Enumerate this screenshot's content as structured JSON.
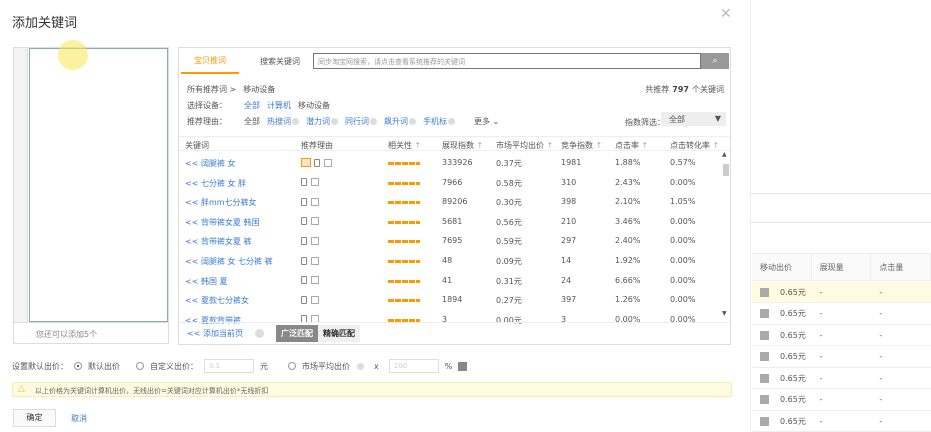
{
  "dialog": {
    "title": "添加关键词",
    "close_icon": "close-icon",
    "remaining": "您还可以添加5个"
  },
  "tabs": [
    {
      "label": "宝贝推词",
      "active": true
    },
    {
      "label": "搜索关键词",
      "active": false
    }
  ],
  "search": {
    "placeholder": "同步淘宝网搜索，请点击查看系统推荐的关键词"
  },
  "breadcrumb": {
    "root": "所有推荐词 >",
    "current": "移动设备"
  },
  "total": {
    "prefix": "共推荐",
    "count": "797",
    "suffix": "个关键词"
  },
  "device": {
    "label": "选择设备：",
    "options": [
      "全部",
      "计算机",
      "移动设备"
    ]
  },
  "reason": {
    "label": "推荐理由：",
    "options": [
      "全部",
      "热搜词",
      "潜力词",
      "同行词",
      "飙升词",
      "手机标"
    ],
    "more": "更多"
  },
  "index_filter": {
    "label": "指数筛选：",
    "value": "全部"
  },
  "columns": [
    "关键词",
    "推荐理由",
    "相关性",
    "展现指数",
    "市场平均出价",
    "竞争指数",
    "点击率",
    "点击转化率"
  ],
  "rows": [
    {
      "kw": "<< 阔腿裤 女",
      "hot": true,
      "imp": "333926",
      "price": "0.37元",
      "comp": "1981",
      "ctr": "1.88%",
      "cvr": "0.57%"
    },
    {
      "kw": "<< 七分裤 女 胖",
      "hot": false,
      "imp": "7966",
      "price": "0.58元",
      "comp": "310",
      "ctr": "2.43%",
      "cvr": "0.00%"
    },
    {
      "kw": "<< 胖mm七分裤女",
      "hot": false,
      "imp": "89206",
      "price": "0.30元",
      "comp": "398",
      "ctr": "2.10%",
      "cvr": "1.05%"
    },
    {
      "kw": "<< 背带裤女夏 韩国",
      "hot": false,
      "imp": "5681",
      "price": "0.56元",
      "comp": "210",
      "ctr": "3.46%",
      "cvr": "0.00%"
    },
    {
      "kw": "<< 背带裤女夏 裤",
      "hot": false,
      "imp": "7695",
      "price": "0.59元",
      "comp": "297",
      "ctr": "2.40%",
      "cvr": "0.00%"
    },
    {
      "kw": "<< 阔腿裤 女 七分裤 裤",
      "hot": false,
      "imp": "48",
      "price": "0.09元",
      "comp": "14",
      "ctr": "1.92%",
      "cvr": "0.00%"
    },
    {
      "kw": "<< 韩国 夏",
      "hot": false,
      "imp": "41",
      "price": "0.31元",
      "comp": "24",
      "ctr": "6.66%",
      "cvr": "0.00%"
    },
    {
      "kw": "<< 夏款七分裤女",
      "hot": false,
      "imp": "1894",
      "price": "0.27元",
      "comp": "397",
      "ctr": "1.26%",
      "cvr": "0.00%"
    },
    {
      "kw": "<< 夏款背带裤",
      "hot": false,
      "imp": "3",
      "price": "0.00元",
      "comp": "3",
      "ctr": "0.00%",
      "cvr": "0.00%"
    }
  ],
  "footer": {
    "add_page": "<< 添加当前页",
    "broad": "广泛匹配",
    "exact": "精确匹配"
  },
  "bid": {
    "label": "设置默认出价：",
    "default": "默认出价",
    "custom": "自定义出价：",
    "custom_value": "0.1",
    "unit": "元",
    "market": "市场平均出价",
    "times": "x",
    "percent_value": "100",
    "percent": "%"
  },
  "warning": "以上价格为关键词计算机出价，无线出价=关键词对应计算机出价*无线折扣",
  "buttons": {
    "ok": "确定",
    "cancel": "取消"
  },
  "background_table": {
    "columns": [
      "移动出价",
      "展现量",
      "点击量"
    ],
    "rows": [
      [
        "0.65元",
        "-",
        "-"
      ],
      [
        "0.65元",
        "-",
        "-"
      ],
      [
        "0.65元",
        "-",
        "-"
      ],
      [
        "0.65元",
        "-",
        "-"
      ],
      [
        "0.65元",
        "-",
        "-"
      ],
      [
        "0.65元",
        "-",
        "-"
      ],
      [
        "0.65元",
        "-",
        "-"
      ]
    ]
  },
  "colors": {
    "accent": "#ff9900",
    "link": "#3a7bd5",
    "warning_bg": "#fffbe0"
  }
}
